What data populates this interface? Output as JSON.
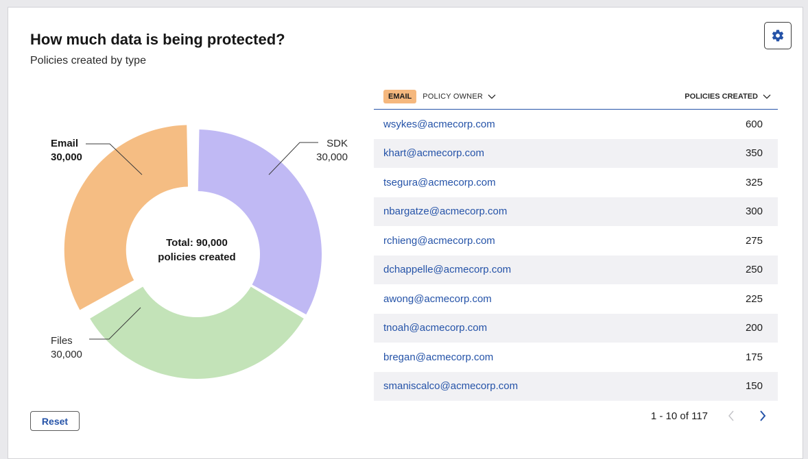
{
  "header": {
    "title": "How much data is being protected?",
    "subtitle": "Policies created by type",
    "settings_icon": "gear-icon"
  },
  "chart_data": {
    "type": "pie",
    "categories": [
      "SDK",
      "Files",
      "Email"
    ],
    "values": [
      30000,
      30000,
      30000
    ],
    "colors": [
      "#c0b9f4",
      "#c3e3b8",
      "#f5bd83"
    ],
    "selected": "Email",
    "labels": [
      {
        "name": "SDK",
        "value": "30,000"
      },
      {
        "name": "Files",
        "value": "30,000"
      },
      {
        "name": "Email",
        "value": "30,000"
      }
    ],
    "center_line1": "Total: 90,000",
    "center_line2": "policies created"
  },
  "reset_label": "Reset",
  "table": {
    "filter_badge": "EMAIL",
    "col_owner": "POLICY OWNER",
    "col_count": "POLICIES CREATED",
    "rows": [
      {
        "owner": "wsykes@acmecorp.com",
        "count": "600"
      },
      {
        "owner": "khart@acmecorp.com",
        "count": "350"
      },
      {
        "owner": "tsegura@acmecorp.com",
        "count": "325"
      },
      {
        "owner": "nbargatze@acmecorp.com",
        "count": "300"
      },
      {
        "owner": "rchieng@acmecorp.com",
        "count": "275"
      },
      {
        "owner": "dchappelle@acmecorp.com",
        "count": "250"
      },
      {
        "owner": "awong@acmecorp.com",
        "count": "225"
      },
      {
        "owner": "tnoah@acmecorp.com",
        "count": "200"
      },
      {
        "owner": "bregan@acmecorp.com",
        "count": "175"
      },
      {
        "owner": "smaniscalco@acmecorp.com",
        "count": "150"
      }
    ]
  },
  "pagination": {
    "range": "1 - 10",
    "of_total": "of 117",
    "prev_icon": "chevron-left-icon",
    "next_icon": "chevron-right-icon"
  },
  "colors": {
    "accent": "#2553a8",
    "email": "#f5bd83",
    "sdk": "#c0b9f4",
    "files": "#c3e3b8"
  }
}
